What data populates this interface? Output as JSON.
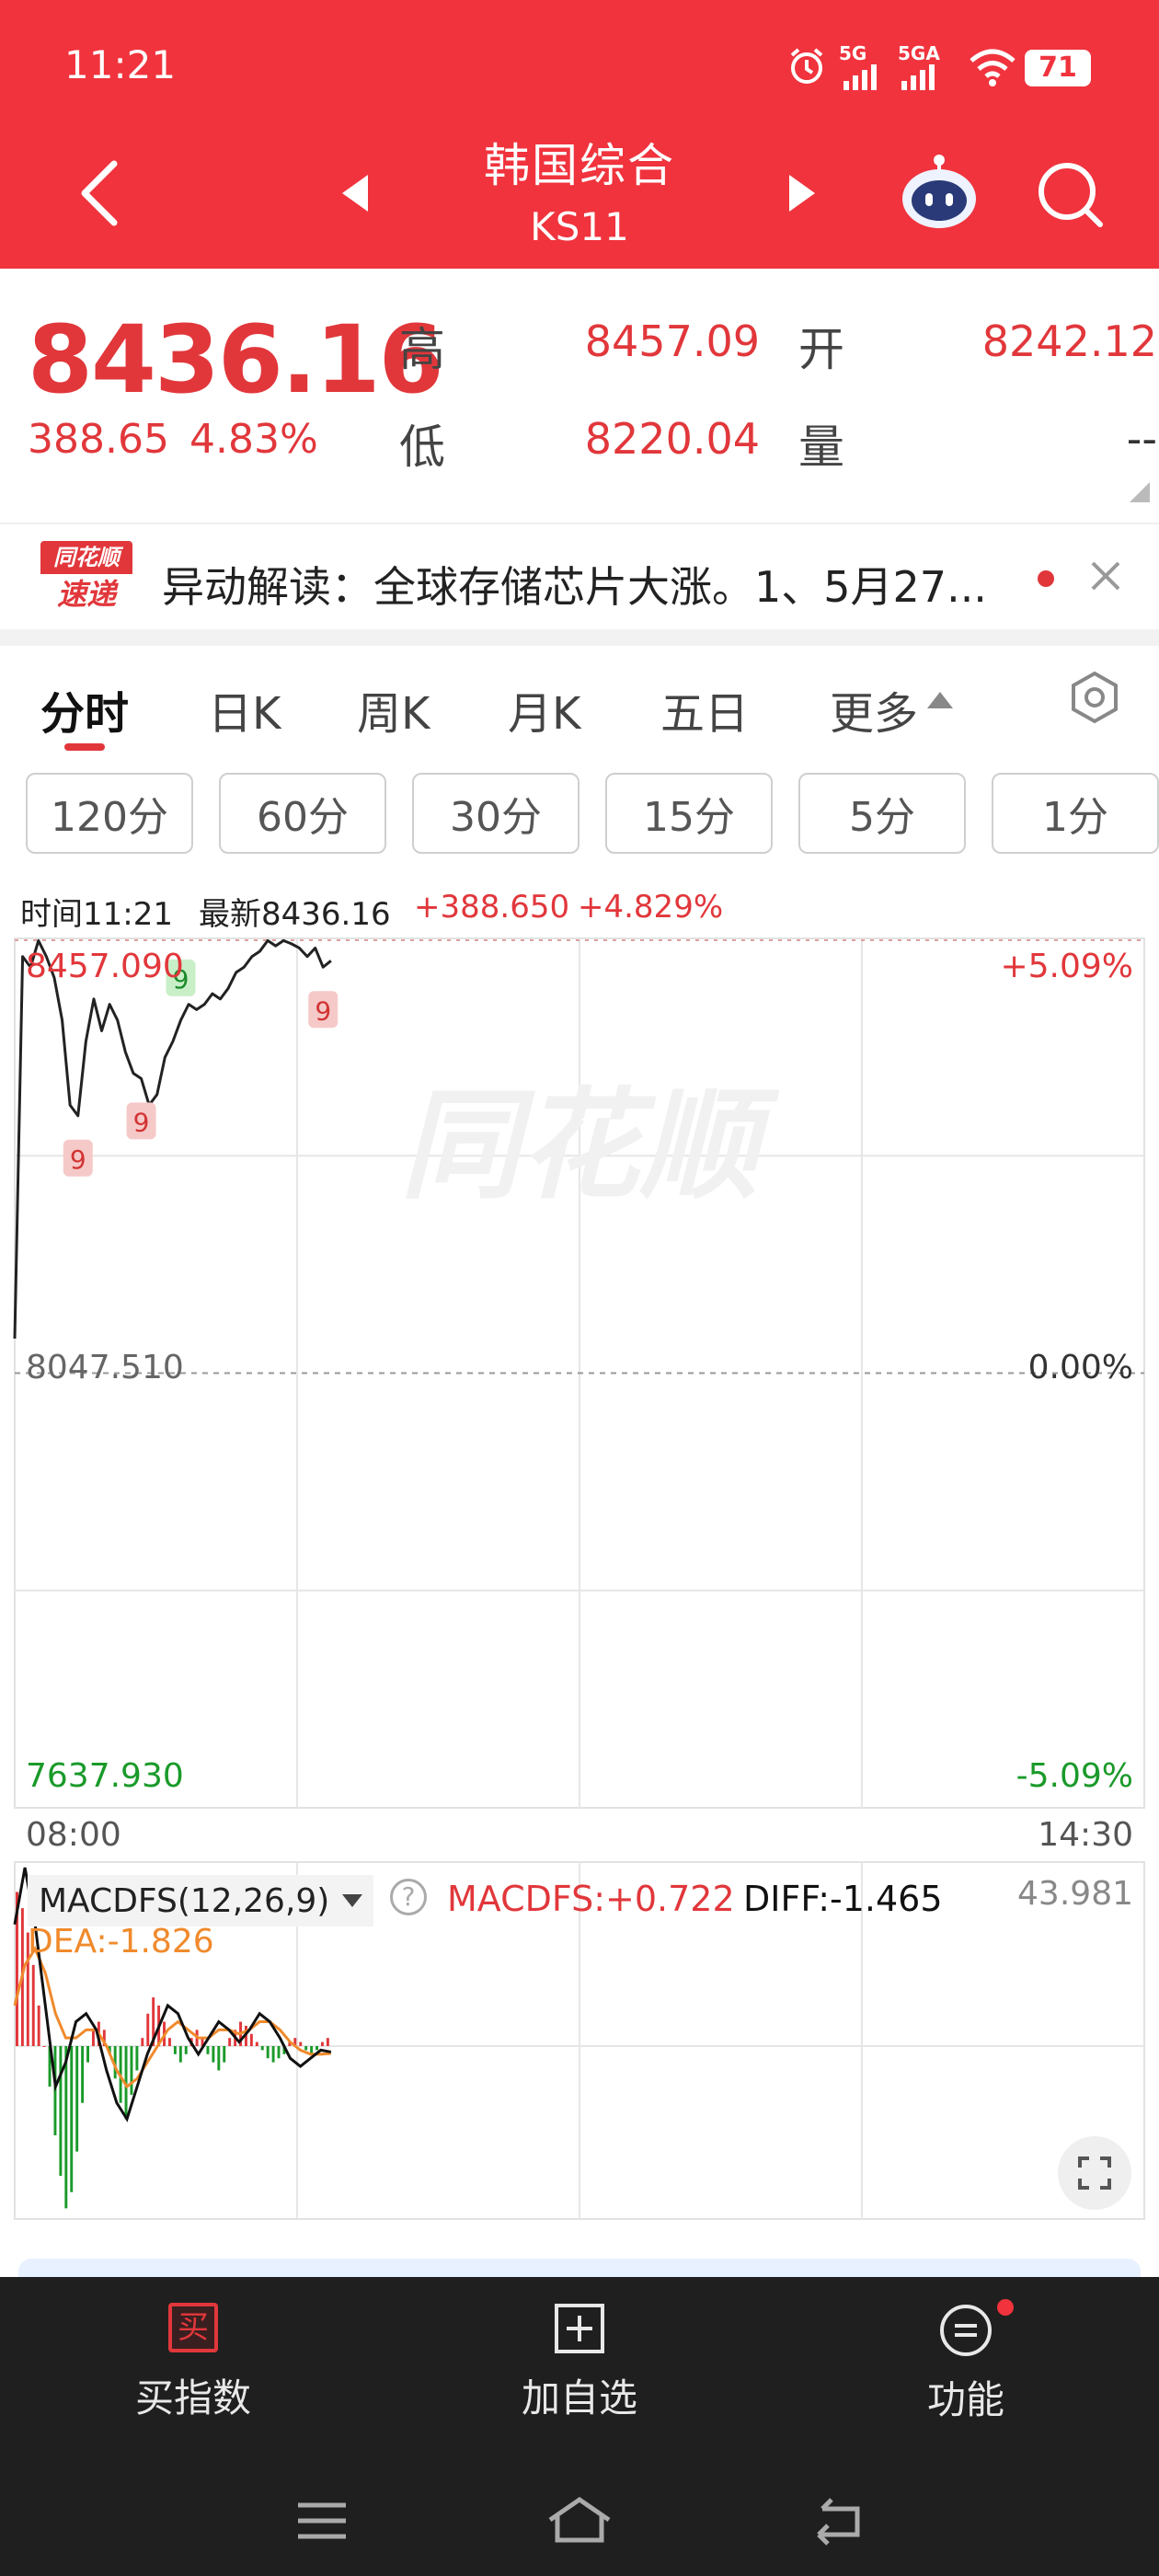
{
  "status": {
    "time": "11:21",
    "signal1": "5G",
    "signal2": "5GA",
    "battery": "71"
  },
  "header": {
    "title": "韩国综合",
    "code": "KS11"
  },
  "quote": {
    "price": "8436.16",
    "change": "388.65",
    "change_pct": "4.83%",
    "high_label": "高",
    "high": "8457.09",
    "open_label": "开",
    "open": "8242.12",
    "low_label": "低",
    "low": "8220.04",
    "volume_label": "量",
    "volume": "--"
  },
  "news": {
    "logo_top": "同花顺",
    "logo_bottom": "速递",
    "text": "异动解读：全球存储芯片大涨。1、5月27..."
  },
  "tabs": [
    {
      "label": "分时"
    },
    {
      "label": "日K"
    },
    {
      "label": "周K"
    },
    {
      "label": "月K"
    },
    {
      "label": "五日"
    },
    {
      "label": "更多"
    }
  ],
  "periods": [
    "120分",
    "60分",
    "30分",
    "15分",
    "5分",
    "1分"
  ],
  "chart_info": {
    "time": "时间11:21",
    "latest": "最新8436.16",
    "change": "+388.650",
    "change_pct": "+4.829%"
  },
  "watermark": "同花顺",
  "colors": {
    "accent": "#f0333d",
    "up": "#e1373b",
    "down": "#1a9a2a",
    "macd_dea": "#f08a2c"
  },
  "chart_data": [
    {
      "type": "line",
      "x_start": "08:00",
      "x_end": "14:30",
      "y_top": "8457.090",
      "y_mid": "8047.510",
      "y_bottom": "7637.930",
      "pct_top": "+5.09%",
      "pct_mid": "0.00%",
      "pct_bottom": "-5.09%",
      "ylim": [
        7637.93,
        8457.09
      ],
      "series": [
        {
          "values": [
            8080,
            8440,
            8430,
            8455,
            8440,
            8420,
            8380,
            8300,
            8290,
            8360,
            8400,
            8370,
            8395,
            8380,
            8350,
            8330,
            8325,
            8300,
            8310,
            8345,
            8360,
            8380,
            8395,
            8390,
            8395,
            8405,
            8400,
            8410,
            8425,
            8430,
            8440,
            8445,
            8455,
            8450,
            8455,
            8452,
            8448,
            8440,
            8448,
            8430,
            8436
          ]
        }
      ],
      "nine_markers": [
        {
          "label": "9",
          "color": "red"
        },
        {
          "label": "9",
          "color": "red"
        },
        {
          "label": "9",
          "color": "green"
        },
        {
          "label": "9",
          "color": "green"
        },
        {
          "label": "9",
          "color": "red"
        }
      ]
    },
    {
      "type": "bar",
      "indicator": "MACDFS(12,26,9)",
      "macdfs": "MACDFS:+0.722",
      "diff": "DIFF:-1.465",
      "dea": "DEA:-1.826",
      "top_value": "43.981",
      "ylim": [
        -44,
        44
      ],
      "histogram": [
        38,
        34,
        28,
        20,
        10,
        0,
        -10,
        -22,
        -32,
        -40,
        -36,
        -26,
        -14,
        -4,
        4,
        6,
        4,
        -2,
        -8,
        -14,
        -18,
        -12,
        -6,
        2,
        8,
        12,
        10,
        6,
        2,
        -2,
        -4,
        -2,
        2,
        4,
        2,
        -2,
        -4,
        -6,
        -4,
        2,
        4,
        6,
        5,
        3,
        1,
        -1,
        -3,
        -4,
        -3,
        -2,
        1,
        2,
        1,
        -1,
        -2,
        -1,
        1,
        2
      ],
      "diff_values": [
        30,
        44,
        30,
        10,
        -10,
        -4,
        6,
        8,
        4,
        -6,
        -14,
        -18,
        -10,
        -2,
        4,
        10,
        8,
        2,
        -2,
        2,
        6,
        4,
        1,
        4,
        8,
        6,
        2,
        -3,
        -5,
        -3,
        -1,
        -1.465
      ],
      "dea_values": [
        10,
        20,
        24,
        18,
        8,
        2,
        2,
        4,
        4,
        0,
        -6,
        -10,
        -8,
        -4,
        0,
        4,
        6,
        4,
        2,
        2,
        4,
        4,
        3,
        4,
        6,
        6,
        4,
        1,
        -1,
        -2,
        -2,
        -1.826
      ]
    }
  ],
  "bottom": {
    "buy_icon": "买",
    "buy": "买指数",
    "add": "加自选",
    "func": "功能"
  }
}
